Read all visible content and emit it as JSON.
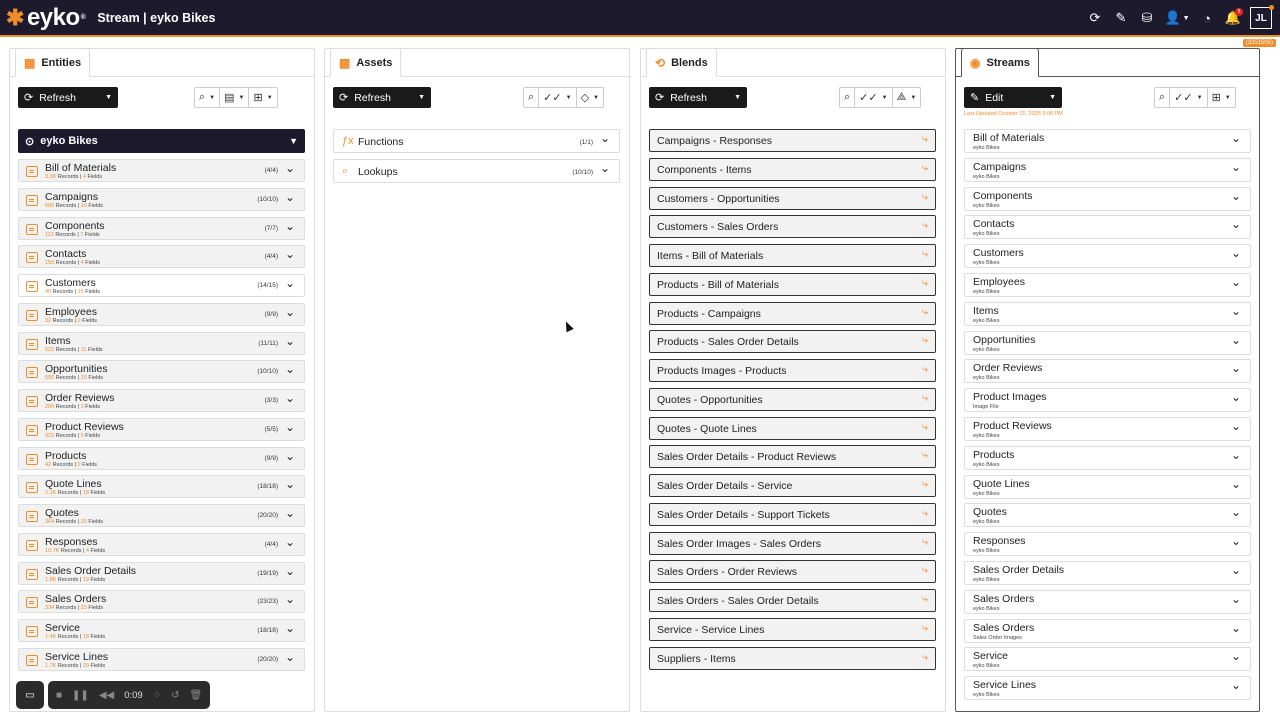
{
  "topbar": {
    "logo_text": "eyko",
    "logo_reg": "®",
    "title": "Stream | eyko Bikes",
    "avatar": "JL",
    "notification_badge": "9",
    "version": "(3351505)",
    "icons": [
      "refresh-icon",
      "brush-icon",
      "database-icon",
      "user-settings-icon",
      "dashboard-icon",
      "bell-icon"
    ]
  },
  "entities": {
    "tab_label": "Entities",
    "refresh_label": "Refresh",
    "group_name": "eyko Bikes",
    "items": [
      {
        "name": "Bill of Materials",
        "records": "3.3K",
        "fields": "4",
        "count": "(4/4)"
      },
      {
        "name": "Campaigns",
        "records": "600",
        "fields": "10",
        "count": "(10/10)"
      },
      {
        "name": "Components",
        "records": "113",
        "fields": "7",
        "count": "(7/7)"
      },
      {
        "name": "Contacts",
        "records": "150",
        "fields": "4",
        "count": "(4/4)"
      },
      {
        "name": "Customers",
        "records": "40",
        "fields": "15",
        "count": "(14/15)"
      },
      {
        "name": "Employees",
        "records": "32",
        "fields": "9",
        "count": "(9/9)"
      },
      {
        "name": "Items",
        "records": "523",
        "fields": "11",
        "count": "(11/11)"
      },
      {
        "name": "Opportunities",
        "records": "500",
        "fields": "10",
        "count": "(10/10)"
      },
      {
        "name": "Order Reviews",
        "records": "200",
        "fields": "3",
        "count": "(3/3)"
      },
      {
        "name": "Product Reviews",
        "records": "923",
        "fields": "5",
        "count": "(5/5)"
      },
      {
        "name": "Products",
        "records": "42",
        "fields": "9",
        "count": "(9/9)"
      },
      {
        "name": "Quote Lines",
        "records": "2.1K",
        "fields": "18",
        "count": "(18/18)"
      },
      {
        "name": "Quotes",
        "records": "364",
        "fields": "20",
        "count": "(20/20)"
      },
      {
        "name": "Responses",
        "records": "10.7K",
        "fields": "4",
        "count": "(4/4)"
      },
      {
        "name": "Sales Order Details",
        "records": "1.8K",
        "fields": "19",
        "count": "(19/19)"
      },
      {
        "name": "Sales Orders",
        "records": "334",
        "fields": "23",
        "count": "(23/23)"
      },
      {
        "name": "Service",
        "records": "1.4K",
        "fields": "18",
        "count": "(18/18)"
      },
      {
        "name": "Service Lines",
        "records": "1.7K",
        "fields": "20",
        "count": "(20/20)"
      }
    ],
    "records_word": "Records",
    "fields_word": "Fields"
  },
  "assets": {
    "tab_label": "Assets",
    "refresh_label": "Refresh",
    "items": [
      {
        "name": "Functions",
        "count": "(1/1)"
      },
      {
        "name": "Lookups",
        "count": "(10/10)"
      }
    ]
  },
  "blends": {
    "tab_label": "Blends",
    "refresh_label": "Refresh",
    "items": [
      "Campaigns - Responses",
      "Components - Items",
      "Customers - Opportunities",
      "Customers - Sales Orders",
      "Items - Bill of Materials",
      "Products - Bill of Materials",
      "Products - Campaigns",
      "Products - Sales Order Details",
      "Products Images - Products",
      "Quotes - Opportunities",
      "Quotes - Quote Lines",
      "Sales Order Details - Product Reviews",
      "Sales Order Details - Service",
      "Sales Order Details - Support Tickets",
      "Sales Order Images - Sales Orders",
      "Sales Orders - Order Reviews",
      "Sales Orders - Sales Order Details",
      "Service - Service Lines",
      "Suppliers - Items"
    ]
  },
  "streams": {
    "tab_label": "Streams",
    "edit_label": "Edit",
    "last_updated": "Last Updated October 15, 2025 3:08 PM",
    "items": [
      {
        "name": "Bill of Materials",
        "sub": "eyko Bikes"
      },
      {
        "name": "Campaigns",
        "sub": "eyko Bikes"
      },
      {
        "name": "Components",
        "sub": "eyko Bikes"
      },
      {
        "name": "Contacts",
        "sub": "eyko Bikes"
      },
      {
        "name": "Customers",
        "sub": "eyko Bikes"
      },
      {
        "name": "Employees",
        "sub": "eyko Bikes"
      },
      {
        "name": "Items",
        "sub": "eyko Bikes"
      },
      {
        "name": "Opportunities",
        "sub": "eyko Bikes"
      },
      {
        "name": "Order Reviews",
        "sub": "eyko Bikes"
      },
      {
        "name": "Product Images",
        "sub": "Image File"
      },
      {
        "name": "Product Reviews",
        "sub": "eyko Bikes"
      },
      {
        "name": "Products",
        "sub": "eyko Bikes"
      },
      {
        "name": "Quote Lines",
        "sub": "eyko Bikes"
      },
      {
        "name": "Quotes",
        "sub": "eyko Bikes"
      },
      {
        "name": "Responses",
        "sub": "eyko Bikes"
      },
      {
        "name": "Sales Order Details",
        "sub": "eyko Bikes"
      },
      {
        "name": "Sales Orders",
        "sub": "eyko Bikes"
      },
      {
        "name": "Sales Orders",
        "sub": "Sales Order Images"
      },
      {
        "name": "Service",
        "sub": "eyko Bikes"
      },
      {
        "name": "Service Lines",
        "sub": "eyko Bikes"
      }
    ]
  },
  "recorder": {
    "time": "0:09"
  },
  "colors": {
    "accent": "#f28c28",
    "dark": "#1e1a2e"
  }
}
